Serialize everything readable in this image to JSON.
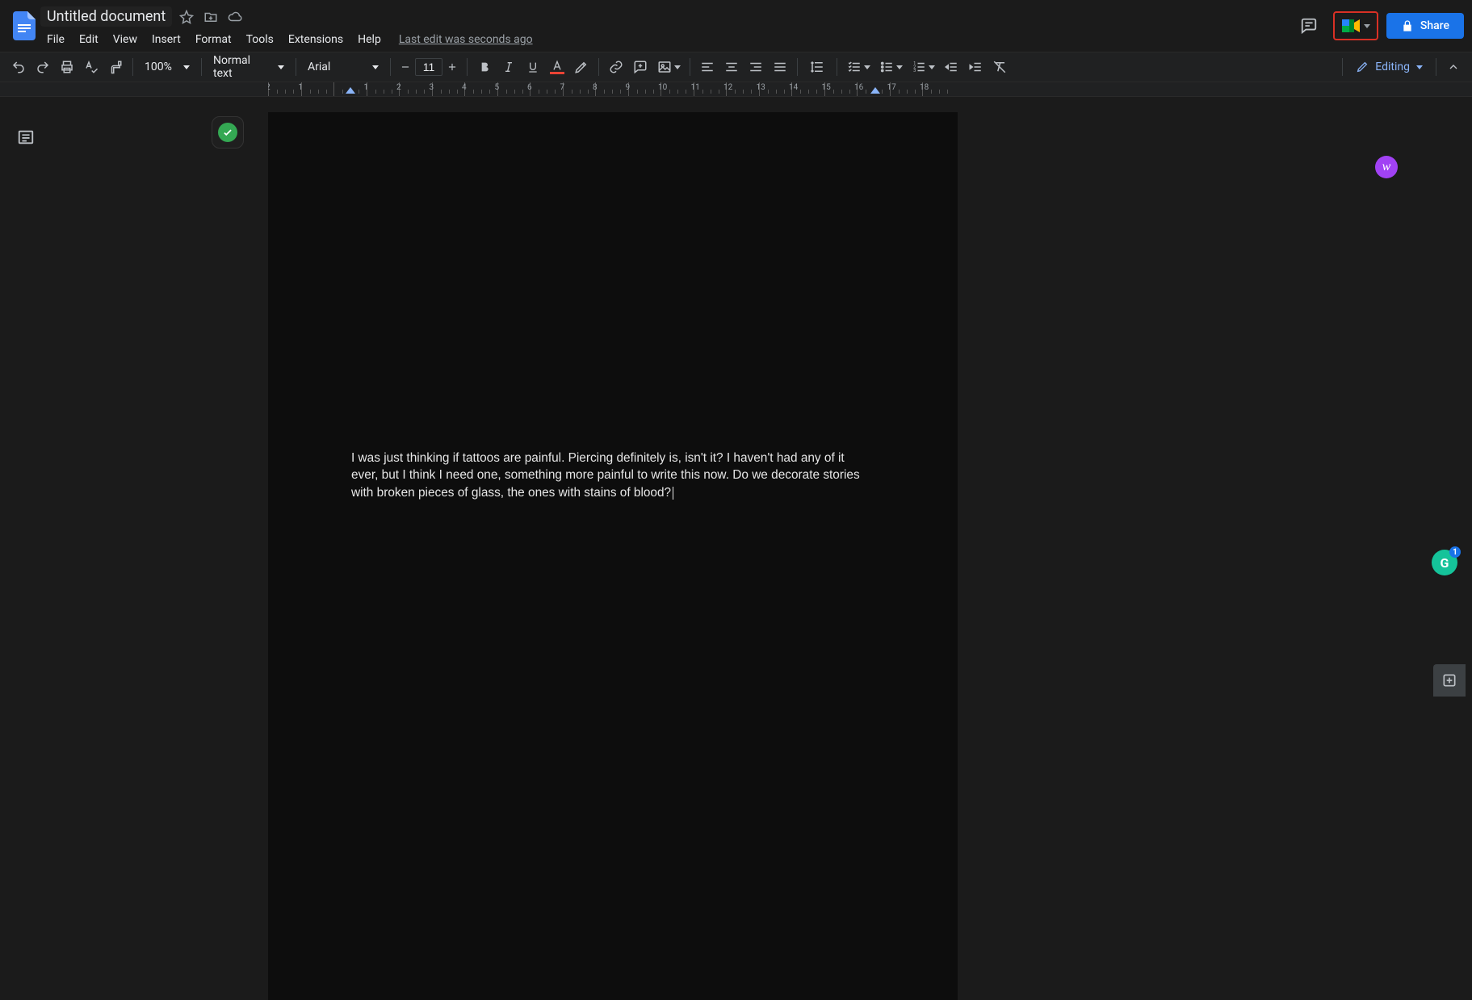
{
  "header": {
    "title": "Untitled document",
    "last_edit": "Last edit was seconds ago",
    "share_label": "Share"
  },
  "menus": [
    "File",
    "Edit",
    "View",
    "Insert",
    "Format",
    "Tools",
    "Extensions",
    "Help"
  ],
  "toolbar": {
    "zoom": "100%",
    "paragraph_style": "Normal text",
    "font": "Arial",
    "font_size": "11",
    "mode": "Editing"
  },
  "ruler": {
    "labels": [
      "2",
      "1",
      "",
      "1",
      "2",
      "3",
      "4",
      "5",
      "6",
      "7",
      "8",
      "9",
      "10",
      "11",
      "12",
      "13",
      "14",
      "15",
      "16",
      "17",
      "18"
    ]
  },
  "document": {
    "body": "I was just thinking if tattoos are painful. Piercing definitely is, isn't it? I haven't had any of it ever, but I think I need one, something more painful to write this now. Do we decorate stories with broken pieces of glass, the ones with stains of blood?"
  },
  "grammarly_badge": "1",
  "colors": {
    "accent": "#1a73e8",
    "text_color_swatch": "#ea4335",
    "spellcheck_ok": "#34a853",
    "meet_highlight_border": "#d93025"
  }
}
